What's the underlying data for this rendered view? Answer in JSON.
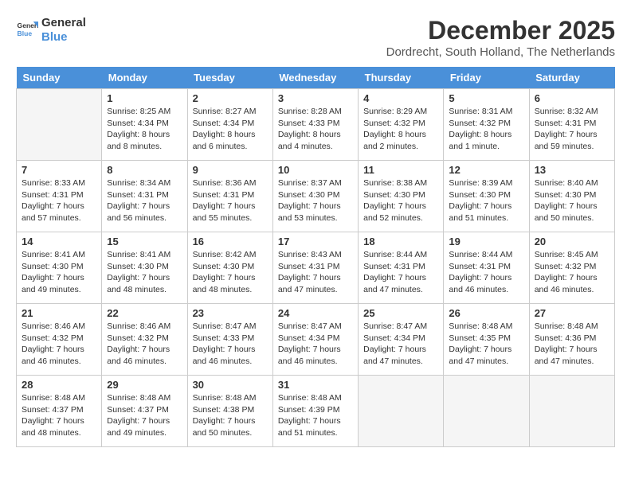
{
  "logo": {
    "line1": "General",
    "line2": "Blue"
  },
  "title": "December 2025",
  "subtitle": "Dordrecht, South Holland, The Netherlands",
  "days": [
    "Sunday",
    "Monday",
    "Tuesday",
    "Wednesday",
    "Thursday",
    "Friday",
    "Saturday"
  ],
  "weeks": [
    [
      {
        "num": "",
        "empty": true
      },
      {
        "num": "1",
        "sunrise": "8:25 AM",
        "sunset": "4:34 PM",
        "daylight": "8 hours and 8 minutes."
      },
      {
        "num": "2",
        "sunrise": "8:27 AM",
        "sunset": "4:34 PM",
        "daylight": "8 hours and 6 minutes."
      },
      {
        "num": "3",
        "sunrise": "8:28 AM",
        "sunset": "4:33 PM",
        "daylight": "8 hours and 4 minutes."
      },
      {
        "num": "4",
        "sunrise": "8:29 AM",
        "sunset": "4:32 PM",
        "daylight": "8 hours and 2 minutes."
      },
      {
        "num": "5",
        "sunrise": "8:31 AM",
        "sunset": "4:32 PM",
        "daylight": "8 hours and 1 minute."
      },
      {
        "num": "6",
        "sunrise": "8:32 AM",
        "sunset": "4:31 PM",
        "daylight": "7 hours and 59 minutes."
      }
    ],
    [
      {
        "num": "7",
        "sunrise": "8:33 AM",
        "sunset": "4:31 PM",
        "daylight": "7 hours and 57 minutes."
      },
      {
        "num": "8",
        "sunrise": "8:34 AM",
        "sunset": "4:31 PM",
        "daylight": "7 hours and 56 minutes."
      },
      {
        "num": "9",
        "sunrise": "8:36 AM",
        "sunset": "4:31 PM",
        "daylight": "7 hours and 55 minutes."
      },
      {
        "num": "10",
        "sunrise": "8:37 AM",
        "sunset": "4:30 PM",
        "daylight": "7 hours and 53 minutes."
      },
      {
        "num": "11",
        "sunrise": "8:38 AM",
        "sunset": "4:30 PM",
        "daylight": "7 hours and 52 minutes."
      },
      {
        "num": "12",
        "sunrise": "8:39 AM",
        "sunset": "4:30 PM",
        "daylight": "7 hours and 51 minutes."
      },
      {
        "num": "13",
        "sunrise": "8:40 AM",
        "sunset": "4:30 PM",
        "daylight": "7 hours and 50 minutes."
      }
    ],
    [
      {
        "num": "14",
        "sunrise": "8:41 AM",
        "sunset": "4:30 PM",
        "daylight": "7 hours and 49 minutes."
      },
      {
        "num": "15",
        "sunrise": "8:41 AM",
        "sunset": "4:30 PM",
        "daylight": "7 hours and 48 minutes."
      },
      {
        "num": "16",
        "sunrise": "8:42 AM",
        "sunset": "4:30 PM",
        "daylight": "7 hours and 48 minutes."
      },
      {
        "num": "17",
        "sunrise": "8:43 AM",
        "sunset": "4:31 PM",
        "daylight": "7 hours and 47 minutes."
      },
      {
        "num": "18",
        "sunrise": "8:44 AM",
        "sunset": "4:31 PM",
        "daylight": "7 hours and 47 minutes."
      },
      {
        "num": "19",
        "sunrise": "8:44 AM",
        "sunset": "4:31 PM",
        "daylight": "7 hours and 46 minutes."
      },
      {
        "num": "20",
        "sunrise": "8:45 AM",
        "sunset": "4:32 PM",
        "daylight": "7 hours and 46 minutes."
      }
    ],
    [
      {
        "num": "21",
        "sunrise": "8:46 AM",
        "sunset": "4:32 PM",
        "daylight": "7 hours and 46 minutes."
      },
      {
        "num": "22",
        "sunrise": "8:46 AM",
        "sunset": "4:32 PM",
        "daylight": "7 hours and 46 minutes."
      },
      {
        "num": "23",
        "sunrise": "8:47 AM",
        "sunset": "4:33 PM",
        "daylight": "7 hours and 46 minutes."
      },
      {
        "num": "24",
        "sunrise": "8:47 AM",
        "sunset": "4:34 PM",
        "daylight": "7 hours and 46 minutes."
      },
      {
        "num": "25",
        "sunrise": "8:47 AM",
        "sunset": "4:34 PM",
        "daylight": "7 hours and 47 minutes."
      },
      {
        "num": "26",
        "sunrise": "8:48 AM",
        "sunset": "4:35 PM",
        "daylight": "7 hours and 47 minutes."
      },
      {
        "num": "27",
        "sunrise": "8:48 AM",
        "sunset": "4:36 PM",
        "daylight": "7 hours and 47 minutes."
      }
    ],
    [
      {
        "num": "28",
        "sunrise": "8:48 AM",
        "sunset": "4:37 PM",
        "daylight": "7 hours and 48 minutes."
      },
      {
        "num": "29",
        "sunrise": "8:48 AM",
        "sunset": "4:37 PM",
        "daylight": "7 hours and 49 minutes."
      },
      {
        "num": "30",
        "sunrise": "8:48 AM",
        "sunset": "4:38 PM",
        "daylight": "7 hours and 50 minutes."
      },
      {
        "num": "31",
        "sunrise": "8:48 AM",
        "sunset": "4:39 PM",
        "daylight": "7 hours and 51 minutes."
      },
      {
        "num": "",
        "empty": true
      },
      {
        "num": "",
        "empty": true
      },
      {
        "num": "",
        "empty": true
      }
    ]
  ],
  "labels": {
    "sunrise": "Sunrise:",
    "sunset": "Sunset:",
    "daylight": "Daylight:"
  }
}
